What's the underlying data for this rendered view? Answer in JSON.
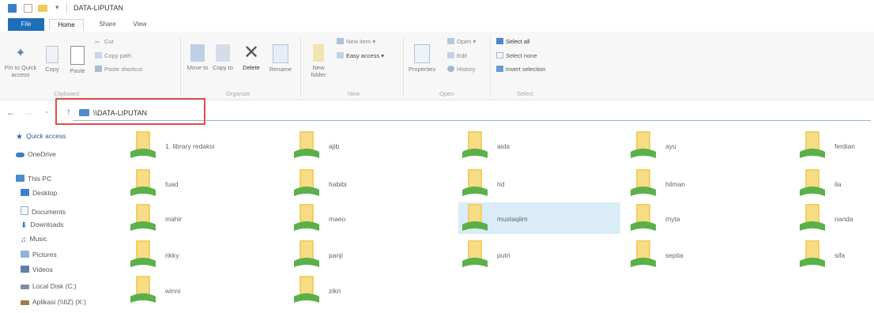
{
  "window": {
    "title": "DATA-LIPUTAN"
  },
  "tabs": [
    {
      "label": "File"
    },
    {
      "label": "Home"
    },
    {
      "label": "Share"
    },
    {
      "label": "View"
    }
  ],
  "ribbon": {
    "clipboard": {
      "pin_label": "Pin to Quick access",
      "copy_label": "Copy",
      "paste_label": "Paste",
      "cut_label": "Cut",
      "copy_path_label": "Copy path",
      "paste_shortcut_label": "Paste shortcut",
      "group_label": "Clipboard"
    },
    "organize": {
      "move_label": "Move to",
      "copy_to_label": "Copy to",
      "delete_label": "Delete",
      "rename_label": "Rename",
      "group_label": "Organize"
    },
    "new": {
      "new_folder_label": "New folder",
      "new_item_label": "New item",
      "easy_access_label": "Easy access",
      "group_label": "New"
    },
    "open": {
      "properties_label": "Properties",
      "open_label": "Open",
      "edit_label": "Edit",
      "history_label": "History",
      "group_label": "Open"
    },
    "select": {
      "select_all_label": "Select all",
      "select_none_label": "Select none",
      "invert_label": "Invert selection",
      "group_label": "Select"
    }
  },
  "address": {
    "path": "\\\\DATA-LIPUTAN"
  },
  "nav": {
    "items": [
      {
        "label": "Quick access",
        "icon": "star-icon"
      },
      {
        "label": "OneDrive",
        "icon": "cloud-icon"
      },
      {
        "label": "This PC",
        "icon": "computer-icon"
      },
      {
        "label": "Desktop",
        "icon": "desktop-icon"
      },
      {
        "label": "Documents",
        "icon": "documents-icon"
      },
      {
        "label": "Downloads",
        "icon": "download-icon"
      },
      {
        "label": "Music",
        "icon": "music-icon"
      },
      {
        "label": "Pictures",
        "icon": "pictures-icon"
      },
      {
        "label": "Videos",
        "icon": "videos-icon"
      },
      {
        "label": "Local Disk (C:)",
        "icon": "disk-icon"
      },
      {
        "label": "Aplikasi (\\\\IIZ) (X:)",
        "icon": "network-drive-icon"
      }
    ]
  },
  "folders": [
    {
      "name": "1. library redaksi"
    },
    {
      "name": "ajib"
    },
    {
      "name": "aida"
    },
    {
      "name": "ayu"
    },
    {
      "name": "ferdian"
    },
    {
      "name": "fuad"
    },
    {
      "name": "habibi"
    },
    {
      "name": "hd"
    },
    {
      "name": "hilman"
    },
    {
      "name": "ila"
    },
    {
      "name": "mahir"
    },
    {
      "name": "maeo"
    },
    {
      "name": "mustaqiim"
    },
    {
      "name": "myta"
    },
    {
      "name": "nanda"
    },
    {
      "name": "rikky"
    },
    {
      "name": "panji"
    },
    {
      "name": "putri"
    },
    {
      "name": "septia"
    },
    {
      "name": "sifa"
    },
    {
      "name": "winni"
    },
    {
      "name": "zikri"
    }
  ],
  "selected_folder": "mustaqiim",
  "colors": {
    "accent": "#1d6fb8",
    "highlight": "#e04c4c",
    "selection": "#d9ecf8",
    "folder": "#f2cf63",
    "folder_overlay": "#5bb04a"
  }
}
